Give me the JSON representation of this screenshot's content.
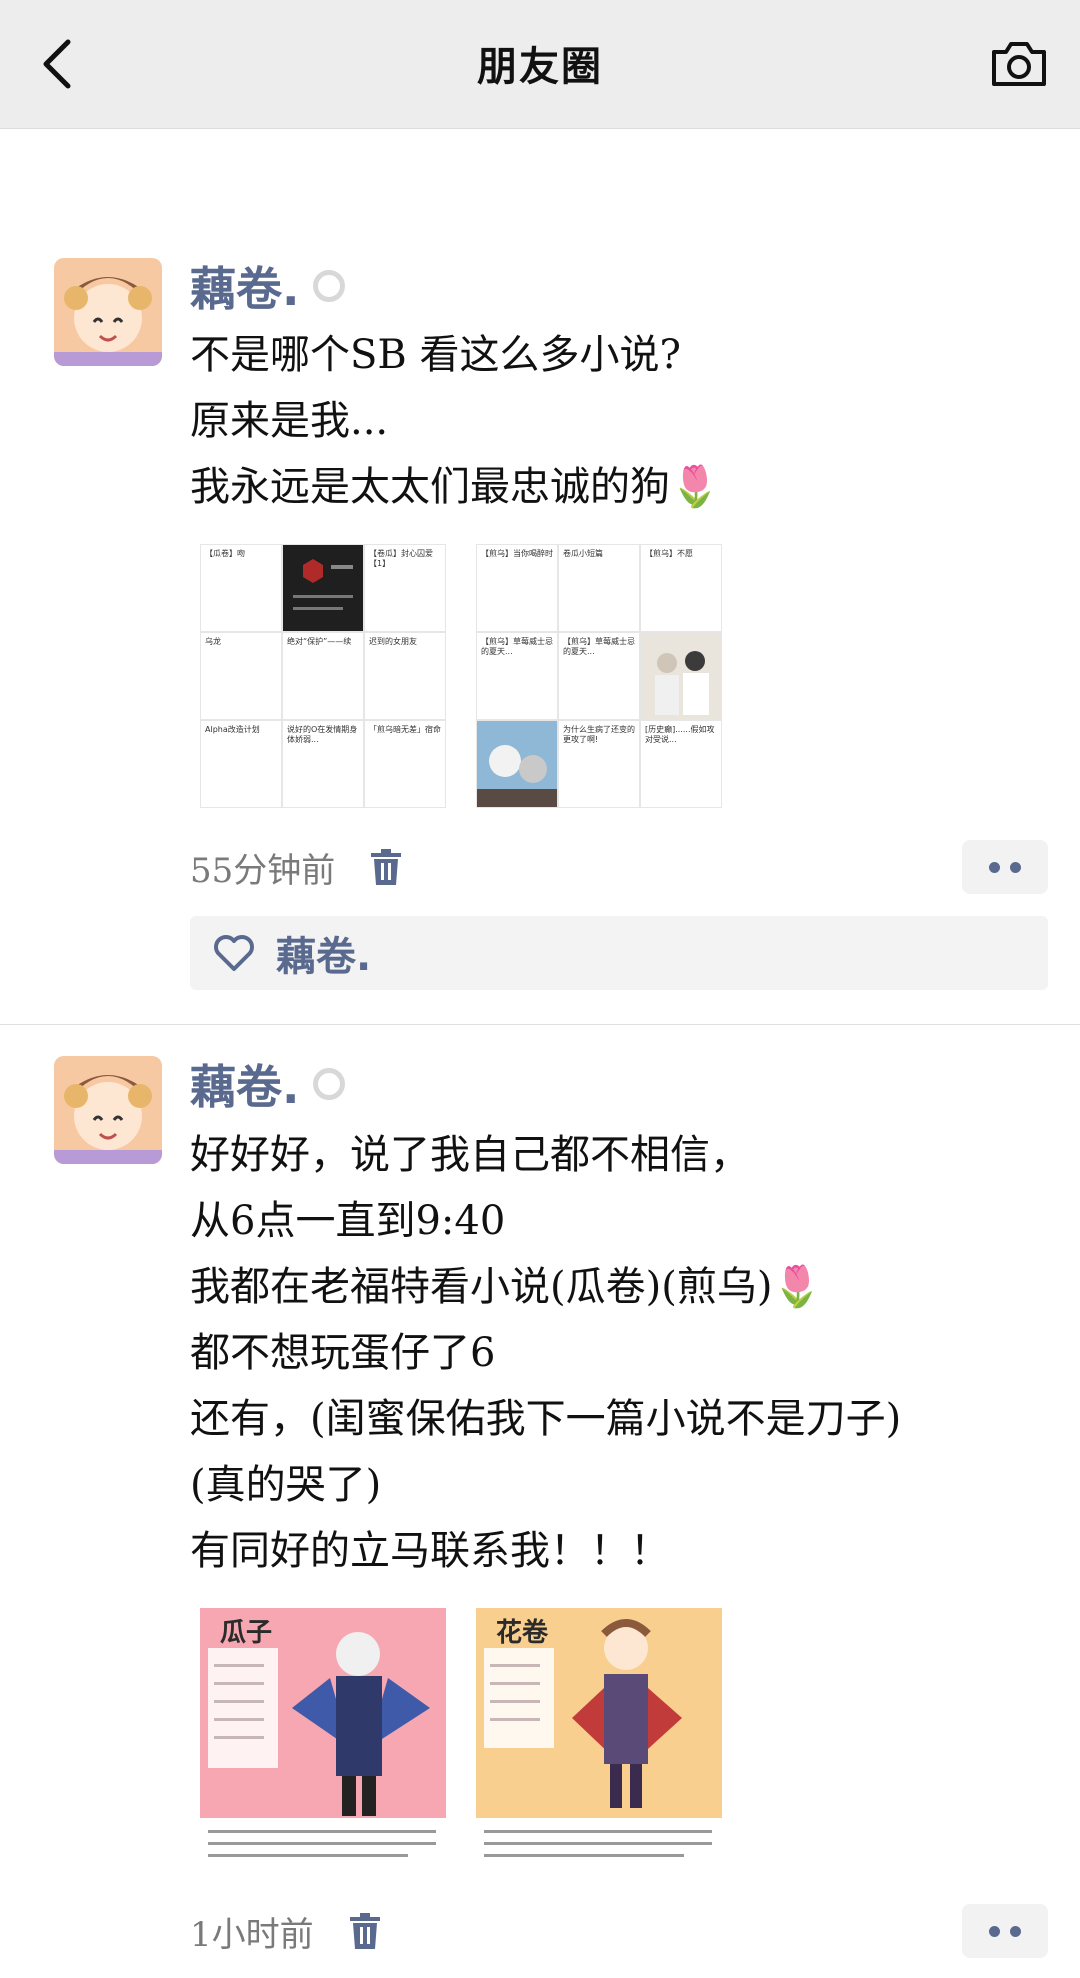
{
  "navbar": {
    "title": "朋友圈",
    "back_icon": "chevron-left-icon",
    "camera_icon": "camera-icon"
  },
  "posts": [
    {
      "nickname": "藕卷.",
      "lines": [
        "不是哪个SB 看这么多小说?",
        "原来是我...",
        "我永远是太太们最忠诚的狗🌷"
      ],
      "time": "55分钟前",
      "likes": {
        "names": "藕卷."
      },
      "images": [
        {
          "cells": [
            "【瓜卷】吻",
            "",
            "【卷瓜】封心囚爱【1】",
            "乌龙",
            "绝对“保护”——续",
            "迟到的女朋友",
            "Alpha改造计划",
            "说好的O在发情期身体娇弱...",
            "「煎乌暗无差」宿命"
          ]
        },
        {
          "cells": [
            "【煎乌】当你喝醉时",
            "卷瓜小短篇",
            "【煎乌】不愿",
            "【煎乌】草莓威士忌的夏天...",
            "【煎乌】草莓威士忌的夏天...",
            "",
            "",
            "为什么生病了还变的更攻了啊!",
            "[历史癫]......假如攻对受说..."
          ]
        }
      ]
    },
    {
      "nickname": "藕卷.",
      "lines": [
        "好好好，说了我自己都不相信，",
        "从6点一直到9:40",
        "我都在老福特看小说(瓜卷)(煎乌)🌷",
        "都不想玩蛋仔了6",
        "还有，(闺蜜保佑我下一篇小说不是刀子)",
        "(真的哭了)",
        "有同好的立马联系我！！！"
      ],
      "time": "1小时前",
      "images": [
        {
          "title": "瓜子"
        },
        {
          "title": "花卷"
        }
      ]
    }
  ]
}
